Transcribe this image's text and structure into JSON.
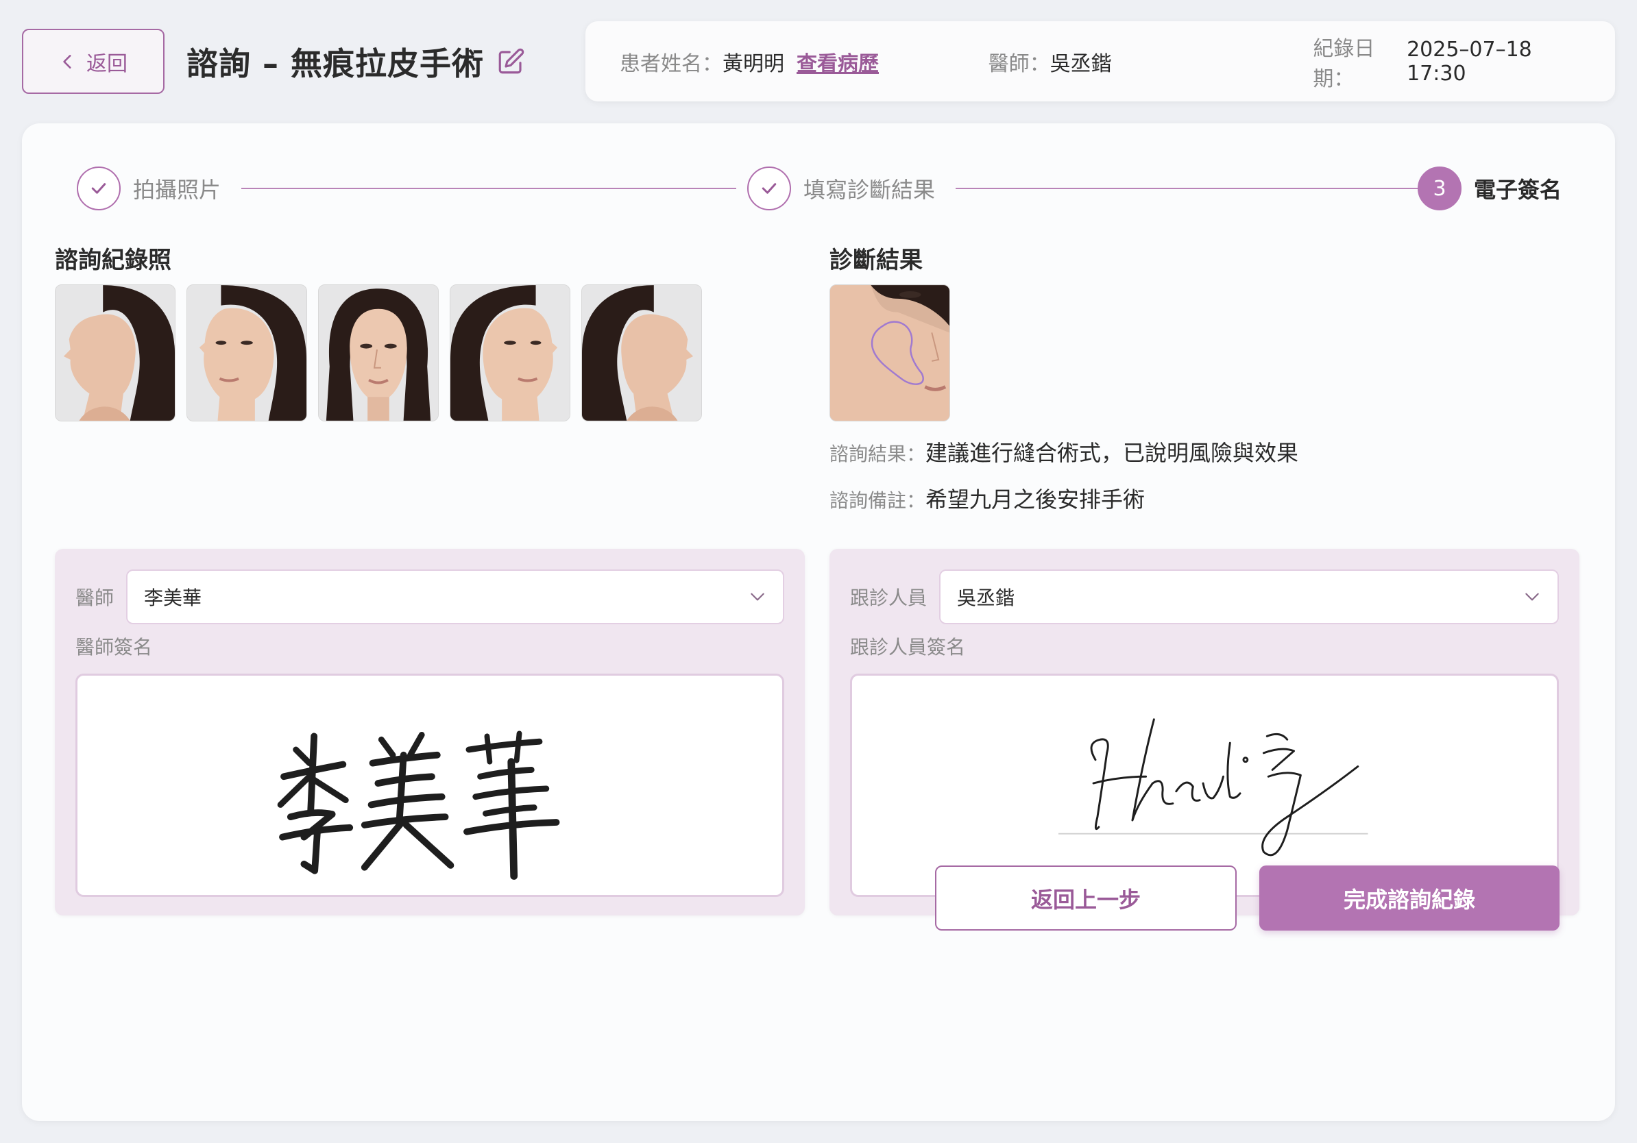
{
  "header": {
    "back_label": "返回",
    "title": "諮詢 – 無痕拉皮手術"
  },
  "info": {
    "patient_label": "患者姓名：",
    "patient_name": "黃明明",
    "history_link": "查看病歷",
    "doctor_label": "醫師：",
    "doctor_name": "吳丞鍇",
    "date_label": "紀錄日期：",
    "date_value": "2025–07–18 17:30"
  },
  "steps": [
    {
      "label": "拍攝照片",
      "status": "done"
    },
    {
      "label": "填寫診斷結果",
      "status": "done"
    },
    {
      "label": "電子簽名",
      "status": "active",
      "number": "3"
    }
  ],
  "photos_section": {
    "title": "諮詢紀錄照",
    "photos": [
      "left-profile",
      "left-three-quarter",
      "front",
      "right-three-quarter",
      "right-profile"
    ]
  },
  "diagnosis": {
    "title": "診斷結果",
    "result_label": "諮詢結果：",
    "result_value": "建議進行縫合術式，已說明風險與效果",
    "note_label": "諮詢備註：",
    "note_value": "希望九月之後安排手術"
  },
  "doctor_panel": {
    "select_label": "醫師",
    "selected": "李美華",
    "signature_label": "醫師簽名"
  },
  "staff_panel": {
    "select_label": "跟診人員",
    "selected": "吳丞鍇",
    "signature_label": "跟診人員簽名"
  },
  "actions": {
    "prev_label": "返回上一步",
    "finish_label": "完成諮詢紀錄"
  },
  "colors": {
    "accent": "#b374b2",
    "panel": "#f0e6f0"
  }
}
